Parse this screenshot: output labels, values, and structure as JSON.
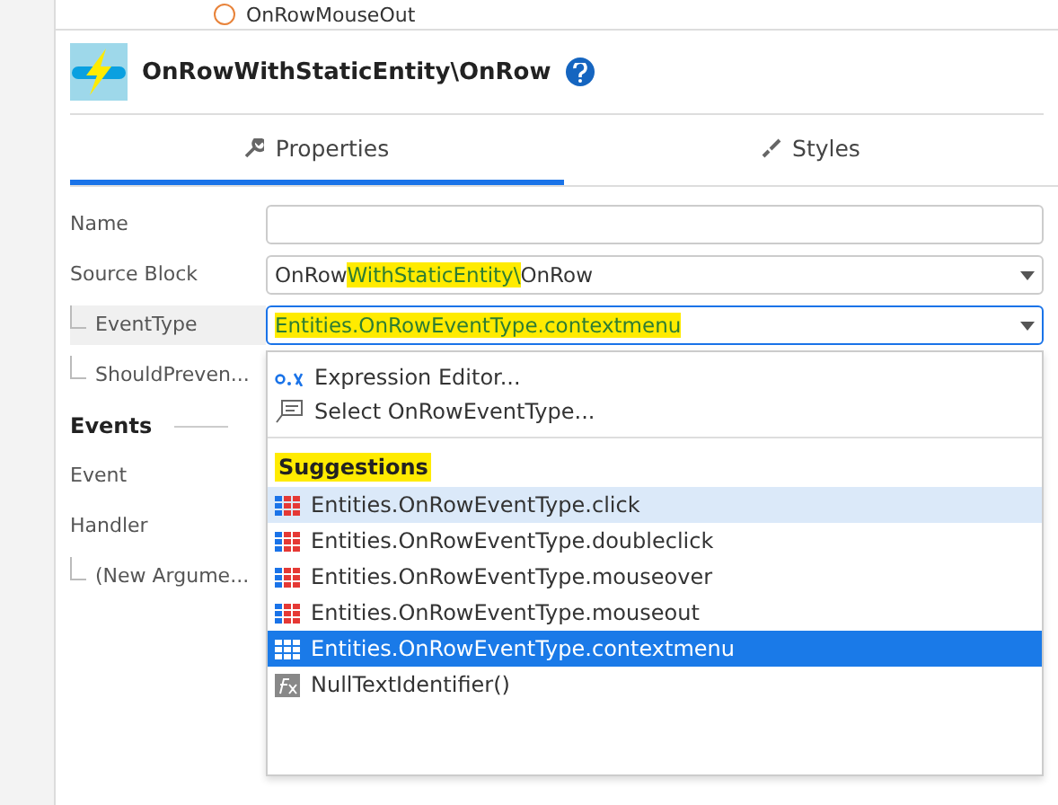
{
  "outline_items": [
    {
      "label": "OnRowMouseOut"
    }
  ],
  "header": {
    "title": "OnRowWithStaticEntity\\OnRow"
  },
  "tabs": [
    {
      "label": "Properties",
      "selected": true
    },
    {
      "label": "Styles",
      "selected": false
    }
  ],
  "properties": [
    {
      "kind": "field",
      "label": "Name"
    },
    {
      "kind": "select",
      "label": "Source Block",
      "value_parts": [
        {
          "text": "OnRow",
          "highlighted": false
        },
        {
          "text": "WithStaticEntity\\",
          "highlighted": true
        },
        {
          "text": "OnRow",
          "highlighted": false
        }
      ]
    },
    {
      "kind": "select",
      "label": "EventType",
      "child": true,
      "focused": true,
      "value_parts": [
        {
          "text": "Entities.OnRowEventType.contextmenu",
          "highlighted": true
        }
      ]
    },
    {
      "kind": "plain",
      "label": "ShouldPreven...",
      "child": true
    },
    {
      "kind": "section",
      "label": "Events"
    },
    {
      "kind": "plain",
      "label": "Event"
    },
    {
      "kind": "plain",
      "label": "Handler"
    },
    {
      "kind": "plain",
      "label": "(New Argume...",
      "child": true
    }
  ],
  "dropdown": {
    "actions": [
      {
        "label": "Expression Editor..."
      },
      {
        "label": "Select OnRowEventType..."
      }
    ],
    "heading": "Suggestions",
    "heading_highlighted": true,
    "items": [
      {
        "kind": "entity",
        "label": "Entities.OnRowEventType.click",
        "selected": false,
        "hovered": true
      },
      {
        "kind": "entity",
        "label": "Entities.OnRowEventType.doubleclick",
        "selected": false,
        "hovered": false
      },
      {
        "kind": "entity",
        "label": "Entities.OnRowEventType.mouseover",
        "selected": false,
        "hovered": false
      },
      {
        "kind": "entity",
        "label": "Entities.OnRowEventType.mouseout",
        "selected": false,
        "hovered": false
      },
      {
        "kind": "entity",
        "label": "Entities.OnRowEventType.contextmenu",
        "selected": true,
        "hovered": false
      },
      {
        "kind": "function",
        "label": "NullTextIdentifier()",
        "selected": false,
        "hovered": false
      }
    ]
  }
}
